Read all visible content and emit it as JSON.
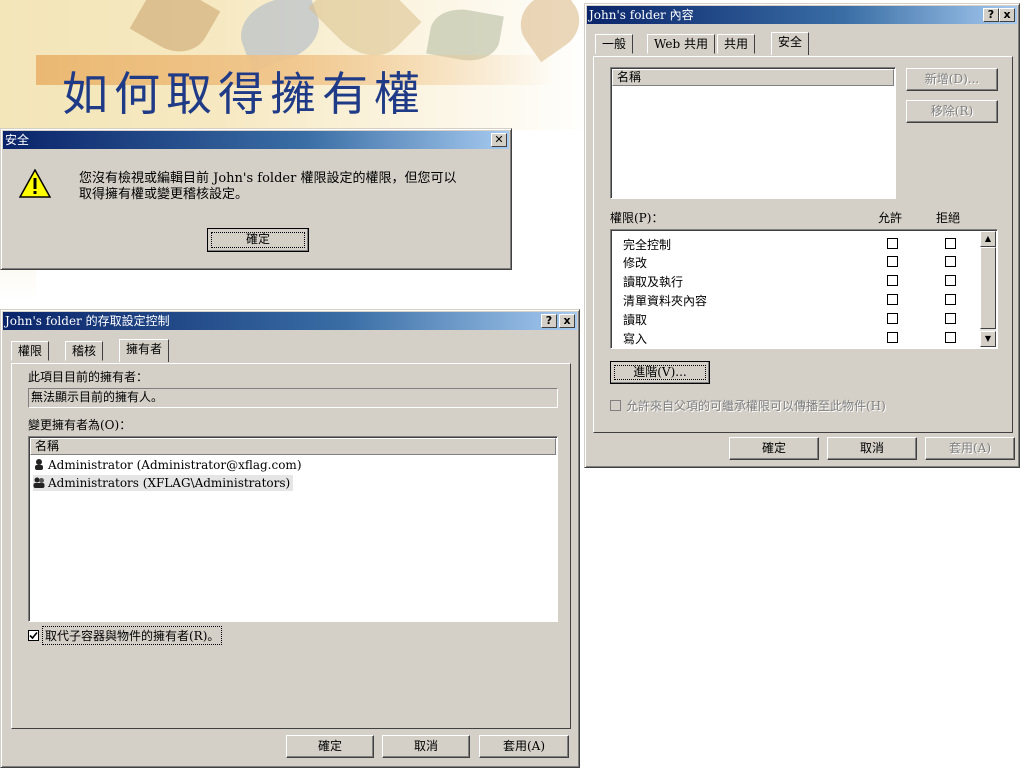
{
  "slide": {
    "title": "如何取得擁有權"
  },
  "security_alert": {
    "title": "安全",
    "message_line1": "您沒有檢視或編輯目前 John's folder 權限設定的權限，但您可以",
    "message_line2": "取得擁有權或變更稽核設定。",
    "ok_label": "確定"
  },
  "properties": {
    "title": "John's folder 內容",
    "help_btn": "?",
    "close_btn": "x",
    "tabs": [
      {
        "label": "一般"
      },
      {
        "label": "Web 共用"
      },
      {
        "label": "共用"
      },
      {
        "label": "安全"
      }
    ],
    "name_header": "名稱",
    "add_label": "新增(D)...",
    "remove_label": "移除(R)",
    "permissions_label": "權限(P)：",
    "allow_header": "允許",
    "deny_header": "拒絕",
    "permissions": [
      {
        "name": "完全控制"
      },
      {
        "name": "修改"
      },
      {
        "name": "讀取及執行"
      },
      {
        "name": "清單資料夾內容"
      },
      {
        "name": "讀取"
      },
      {
        "name": "寫入"
      }
    ],
    "advanced_label": "進階(V)...",
    "inherit_label": "允許來自父項的可繼承權限可以傳播至此物件(H)",
    "ok_label": "確定",
    "cancel_label": "取消",
    "apply_label": "套用(A)"
  },
  "acl": {
    "title": "John's folder 的存取設定控制",
    "help_btn": "?",
    "close_btn": "x",
    "tabs": [
      {
        "label": "權限"
      },
      {
        "label": "稽核"
      },
      {
        "label": "擁有者"
      }
    ],
    "current_owner_label": "此項目目前的擁有者：",
    "current_owner_value": "無法顯示目前的擁有人。",
    "change_owner_label": "變更擁有者為(O)：",
    "name_header": "名稱",
    "users": [
      {
        "name": "Administrator (Administrator@xflag.com)"
      },
      {
        "name": "Administrators (XFLAG\\Administrators)"
      }
    ],
    "replace_label": "取代子容器與物件的擁有者(R)。",
    "ok_label": "確定",
    "cancel_label": "取消",
    "apply_label": "套用(A)"
  },
  "colors": {
    "title_blue": "#1f3a86",
    "titlebar_start": "#0a246a",
    "dialog_face": "#d4d0c8"
  }
}
